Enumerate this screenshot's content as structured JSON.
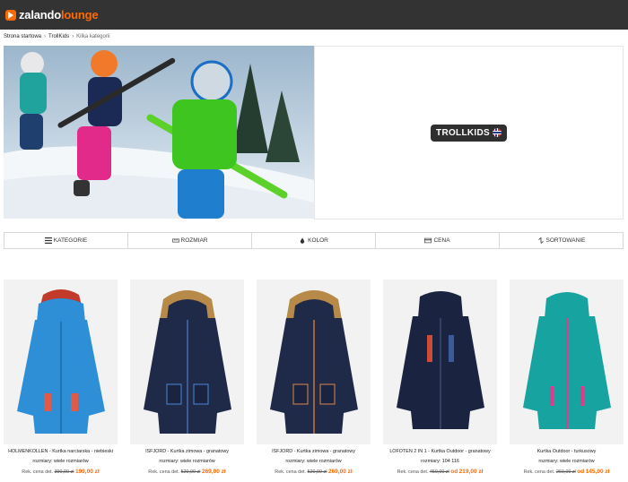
{
  "header": {
    "logo_part1": "zalando",
    "logo_part2": "lounge"
  },
  "breadcrumb": {
    "items": [
      "Strona startowa",
      "TrollKids",
      "Kilka kategorii"
    ]
  },
  "brand": {
    "name": "TROLLKIDS"
  },
  "filters": [
    {
      "label": "KATEGORIE",
      "icon": "list-icon"
    },
    {
      "label": "ROZMIAR",
      "icon": "ruler-icon"
    },
    {
      "label": "KOLOR",
      "icon": "drop-icon"
    },
    {
      "label": "CENA",
      "icon": "card-icon"
    },
    {
      "label": "SORTOWANIE",
      "icon": "sort-icon"
    }
  ],
  "products": [
    {
      "name": "HOLMENKOLLEN - Kurtka narciarska - niebieski",
      "sizes": "rozmiary: wiele rozmiarów",
      "price_label": "Rek. cena det.",
      "old_price": "390,00 zł",
      "new_price": "199,00 zł",
      "new_price_prefix": "",
      "color": "#2e8fd6"
    },
    {
      "name": "ISFJORD - Kurtka zimowa - granatowy",
      "sizes": "rozmiary: wiele rozmiarów",
      "price_label": "Rek. cena det.",
      "old_price": "520,00 zł",
      "new_price": "269,00 zł",
      "new_price_prefix": "",
      "color": "#1f2a48"
    },
    {
      "name": "ISFJORD - Kurtka zimowa - granatowy",
      "sizes": "rozmiary: wiele rozmiarów",
      "price_label": "Rek. cena det.",
      "old_price": "520,00 zł",
      "new_price": "269,00 zł",
      "new_price_prefix": "",
      "color": "#1f2a48"
    },
    {
      "name": "LOFOTEN 2 IN 1 - Kurtka Outdoor - granatowy",
      "sizes": "rozmiary: 104 116",
      "price_label": "Rek. cena det.",
      "old_price": "450,00 zł",
      "new_price": "219,00 zł",
      "new_price_prefix": "od",
      "color": "#1a2440"
    },
    {
      "name": "Kurtka Outdoor - turkusowy",
      "sizes": "rozmiary: wiele rozmiarów",
      "price_label": "Rek. cena det.",
      "old_price": "260,00 zł",
      "new_price": "145,00 zł",
      "new_price_prefix": "od",
      "color": "#17a3a0"
    }
  ]
}
